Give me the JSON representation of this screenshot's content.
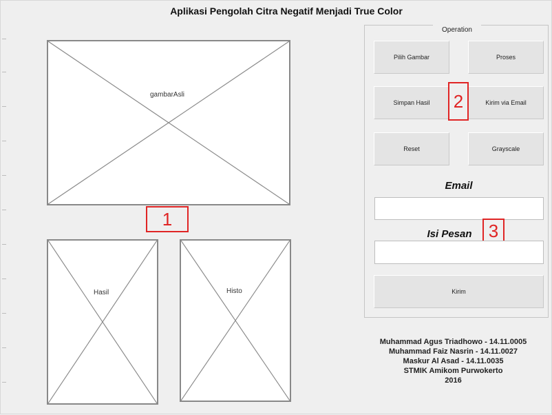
{
  "window": {
    "title": "Aplikasi Pengolah Citra Negatif Menjadi True Color"
  },
  "axes": {
    "main_label": "gambarAsli",
    "result_label": "Hasil",
    "histo_label": "Histo"
  },
  "operation": {
    "legend": "Operation",
    "buttons": {
      "pilih_gambar": "Pilih Gambar",
      "proses": "Proses",
      "simpan_hasil": "Simpan Hasil",
      "kirim_via_email": "Kirim via Email",
      "reset": "Reset",
      "grayscale": "Grayscale",
      "kirim": "Kirim"
    },
    "email_label": "Email",
    "email_value": "",
    "isi_pesan_label": "Isi Pesan",
    "isi_pesan_value": ""
  },
  "markers": [
    "1",
    "2",
    "3"
  ],
  "credits": [
    "Muhammad Agus Triadhowo - 14.11.0005",
    "Muhammad Faiz Nasrin - 14.11.0027",
    "Maskur Al Asad - 14.11.0035",
    "STMIK Amikom Purwokerto",
    "2016"
  ],
  "colors": {
    "marker": "#e02424",
    "background": "#efefef",
    "axes_fill": "#ffffff",
    "axes_border": "#888888"
  }
}
